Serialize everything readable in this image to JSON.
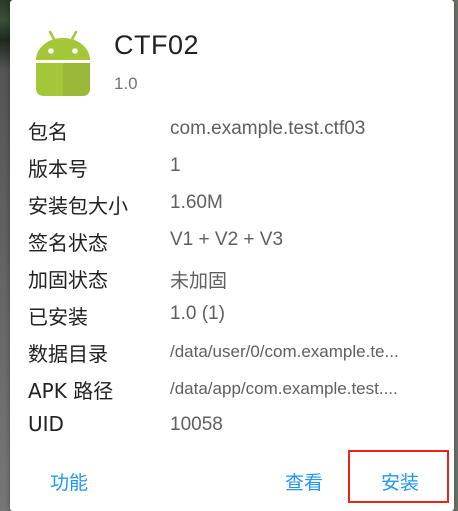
{
  "app": {
    "name": "CTF02",
    "version": "1.0",
    "icon": "android-robot-icon",
    "icon_color": "#a4c639"
  },
  "info_rows": [
    {
      "label": "包名",
      "value": "com.example.test.ctf03"
    },
    {
      "label": "版本号",
      "value": "1"
    },
    {
      "label": "安装包大小",
      "value": "1.60M"
    },
    {
      "label": "签名状态",
      "value": "V1 + V2 + V3"
    },
    {
      "label": "加固状态",
      "value": "未加固"
    },
    {
      "label": "已安装",
      "value": "1.0 (1)"
    },
    {
      "label": "数据目录",
      "value": "/data/user/0/com.example.te..."
    },
    {
      "label": "APK 路径",
      "value": "/data/app/com.example.test...."
    },
    {
      "label": "UID",
      "value": "10058"
    }
  ],
  "actions": {
    "function_label": "功能",
    "view_label": "查看",
    "install_label": "安装"
  },
  "colors": {
    "accent": "#2196f3",
    "highlight": "#e8251c"
  }
}
